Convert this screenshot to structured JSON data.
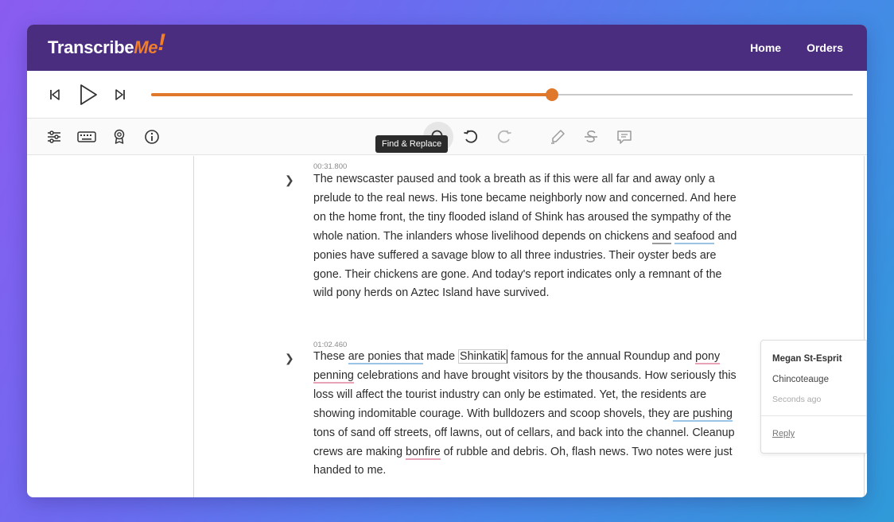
{
  "app": {
    "logo_main": "Transcribe",
    "logo_accent": "Me",
    "logo_bang": "!"
  },
  "nav": {
    "home": "Home",
    "orders": "Orders"
  },
  "player": {
    "progress_fraction": 0.571
  },
  "toolbar": {
    "tooltip": "Find & Replace",
    "icons": [
      "settings-sliders-icon",
      "keyboard-icon",
      "award-ribbon-icon",
      "info-icon",
      "search-icon",
      "undo-icon",
      "redo-icon",
      "highlighter-icon",
      "strikethrough-icon",
      "comment-icon"
    ]
  },
  "segments": [
    {
      "timestamp": "00:31.800",
      "parts": {
        "p1": "The newscaster paused and took a breath as if this were all far and away only a prelude to the real news. His tone became neighborly now and concerned. And here on the home front, the tiny flooded island of Shink has aroused the sympathy of the whole nation. The inlanders whose livelihood depends on chickens ",
        "u1": "and",
        "sp1": " ",
        "u2": "seafood",
        "p2": " and ponies have suffered a savage blow to all three industries. Their oyster beds are gone. Their chickens are gone. And today's report indicates only a remnant of the wild pony herds on Aztec Island have survived."
      }
    },
    {
      "timestamp": "01:02.460",
      "parts": {
        "p1": "These ",
        "u1": "are ponies that",
        "p2": " made ",
        "u2": "Shinkatik",
        "p3": " famous for the annual Roundup and ",
        "u3": "pony penning",
        "p4": " celebrations and have brought visitors by the thousands. How seriously this loss will affect the tourist industry can only be estimated. Yet, the residents are showing indomitable courage. With bulldozers and scoop shovels, they ",
        "u4": "are pushing",
        "p5": " tons of sand off streets, off lawns, out of cellars, and back into the channel. Cleanup crews are making ",
        "u5": "bonfire",
        "p6": " of rubble and debris. Oh, flash news. Two notes were just handed to me."
      }
    }
  ],
  "comment": {
    "author": "Megan St-Esprit",
    "text": "Chincoteauge",
    "time": "Seconds ago",
    "reply": "Reply"
  },
  "colors": {
    "header_bg": "#4b2d7f",
    "accent_orange": "#e0782c",
    "underline_blue": "#9ac4e6",
    "underline_pink": "#e8a3b6"
  }
}
